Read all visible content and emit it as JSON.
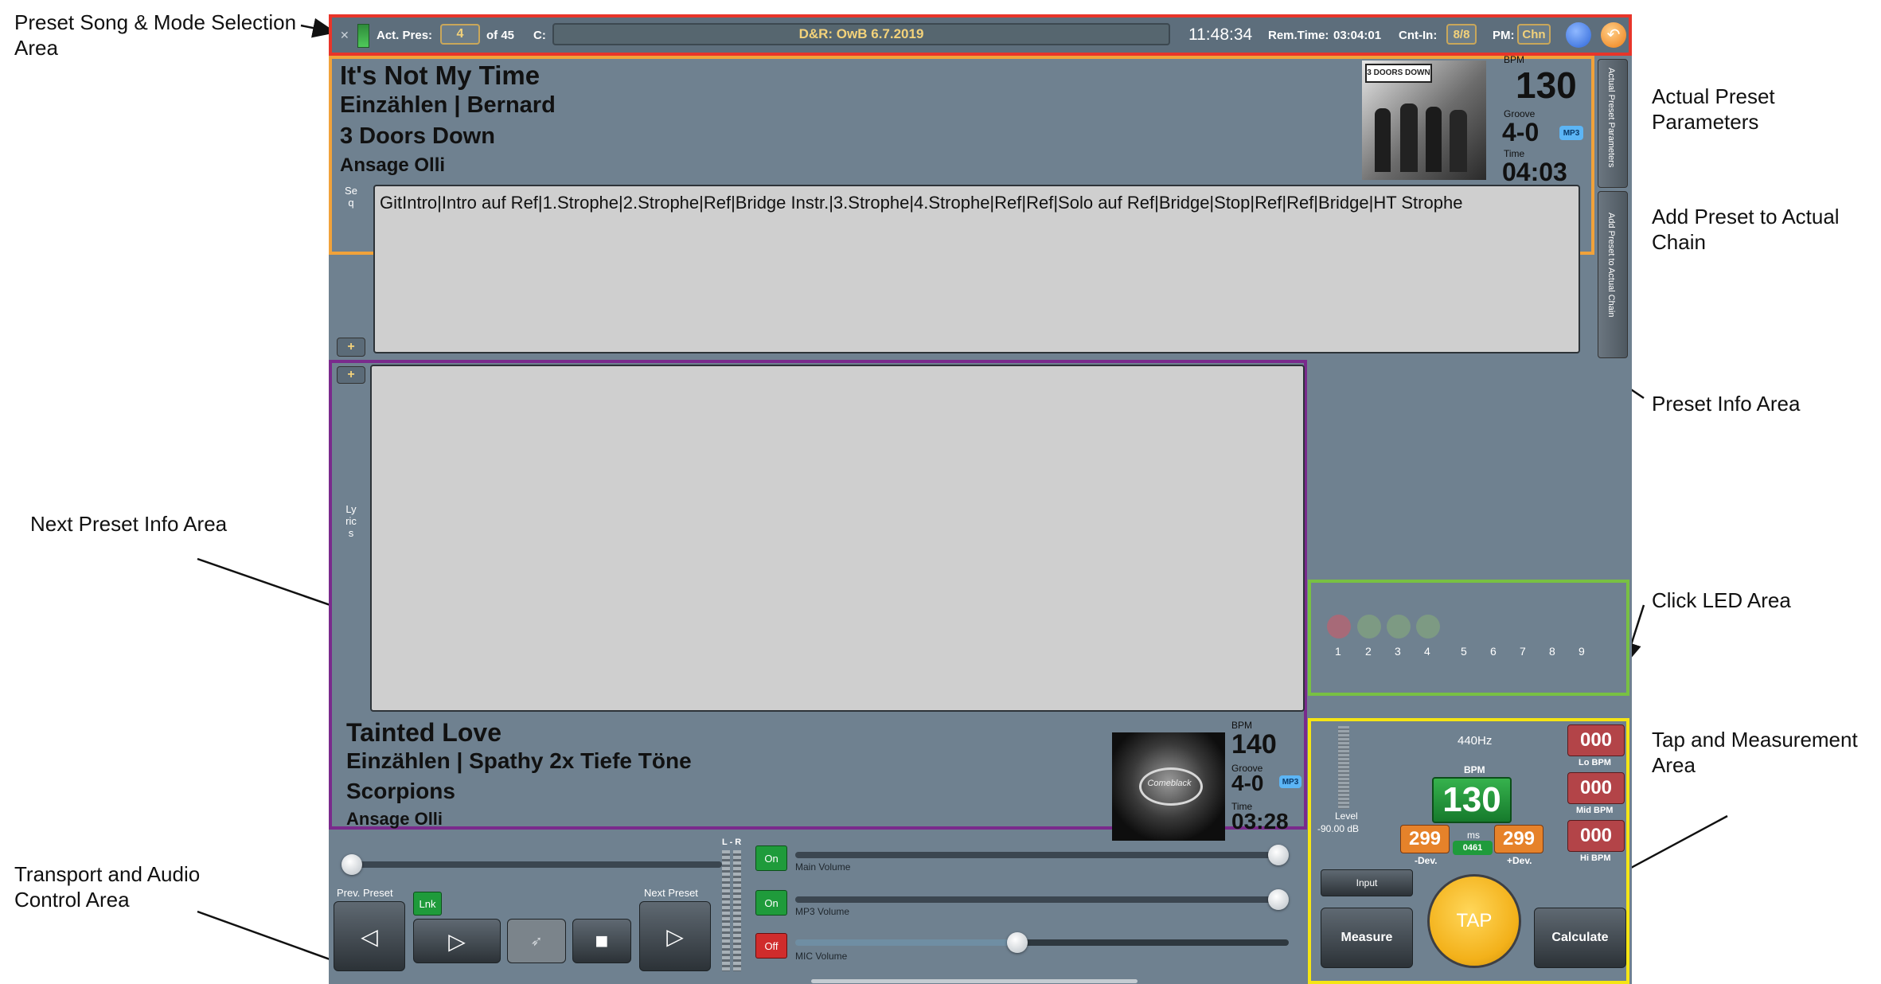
{
  "annotations": {
    "preset_song_mode": "Preset Song & Mode Selection Area",
    "actual_preset_params": "Actual Preset Parameters",
    "add_preset_chain": "Add Preset to Actual Chain",
    "preset_info": "Preset Info Area",
    "next_preset_info": "Next Preset Info Area",
    "click_led": "Click LED Area",
    "tap_measure": "Tap and Measurement Area",
    "transport_audio": "Transport and Audio Control Area"
  },
  "topbar": {
    "act_pres_label": "Act. Pres:",
    "act_pres_value": "4",
    "of_total": "of 45",
    "chain_label": "C:",
    "chain_name": "D&R: OwB 6.7.2019",
    "clock": "11:48:34",
    "rem_time_label": "Rem.Time:",
    "rem_time_value": "03:04:01",
    "cnt_in_label": "Cnt-In:",
    "cnt_in_value": "8/8",
    "pm_label": "PM:",
    "pm_value": "Chn"
  },
  "current": {
    "title": "It's Not My Time",
    "line2": "Einzählen | Bernard",
    "artist": "3 Doors Down",
    "line4": "Ansage Olli",
    "bpm_label": "BPM",
    "bpm": "130",
    "groove_label": "Groove",
    "groove": "4-0",
    "format": "MP3",
    "time_label": "Time",
    "time": "04:03",
    "sequence": "GitIntro|Intro auf Ref|1.Strophe|2.Strophe|Ref|Bridge Instr.|3.Strophe|4.Strophe|Ref|Ref|Solo auf Ref|Bridge|Stop|Ref|Ref|Bridge|HT Strophe",
    "seq_side_label": "Seq",
    "plus": "+",
    "side_tab1": "Actual Preset Parameters",
    "side_tab2": "Add Preset to Actual Chain"
  },
  "next": {
    "lyrics_side_label": "Lyrics",
    "plus": "+",
    "title": "Tainted Love",
    "line2": "Einzählen | Spathy 2x Tiefe Töne",
    "artist": "Scorpions",
    "line4": "Ansage Olli",
    "bpm_label": "BPM",
    "bpm": "140",
    "groove_label": "Groove",
    "groove": "4-0",
    "format": "MP3",
    "time_label": "Time",
    "time": "03:28"
  },
  "leds": [
    "1",
    "2",
    "3",
    "4",
    "5",
    "6",
    "7",
    "8",
    "9"
  ],
  "tap": {
    "freq": "440Hz",
    "bpm_label": "BPM",
    "bpm": "130",
    "ms_label": "ms",
    "minus_dev": "299",
    "minus_dev_label": "-Dev.",
    "plus_dev": "299",
    "plus_dev_label": "+Dev.",
    "ms_value": "0461",
    "lo_bpm": "000",
    "lo_bpm_label": "Lo BPM",
    "mid_bpm": "000",
    "mid_bpm_label": "Mid BPM",
    "hi_bpm": "000",
    "hi_bpm_label": "Hi BPM",
    "level_label": "Level",
    "level_db": "-90.00 dB",
    "input_btn": "Input",
    "measure_btn": "Measure",
    "tap_btn": "TAP",
    "calc_btn": "Calculate"
  },
  "transport": {
    "prev_label": "Prev. Preset",
    "next_label": "Next Preset",
    "lnk": "Lnk",
    "lr": "L - R",
    "main_on": "On",
    "mp3_on": "On",
    "mic_off": "Off",
    "main_vol": "Main Volume",
    "mp3_vol": "MP3 Volume",
    "mic_vol": "MIC Volume",
    "main_level": 1.0,
    "mp3_level": 1.0,
    "mic_level": 0.45,
    "position": 0.0
  },
  "colors": {
    "app_bg": "#6f8190",
    "frame_top": "#e8352a",
    "frame_current": "#f1a23a",
    "frame_next": "#7a2a8c",
    "frame_led": "#78c043",
    "frame_tap": "#f5e514",
    "green": "#1f9b3b",
    "orange": "#e6822a",
    "red_btn": "#b34448"
  }
}
